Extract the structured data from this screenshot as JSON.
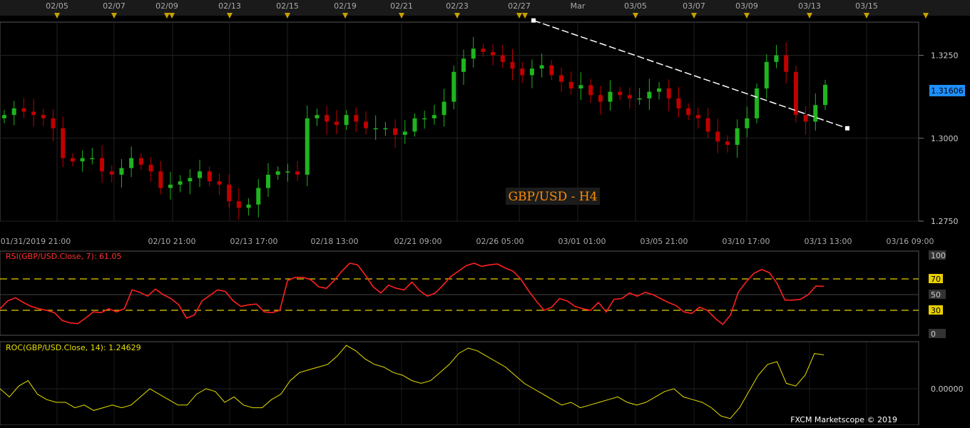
{
  "top_dates": [
    "02/05",
    "02/07",
    "02/09",
    "02/13",
    "02/15",
    "02/19",
    "02/21",
    "02/23",
    "02/27",
    "Mar",
    "03/05",
    "03/07",
    "03/09",
    "03/13",
    "03/15"
  ],
  "main": {
    "title": "GBP/USD - H4",
    "price_ticks": [
      "1.3250",
      "1.3000",
      "1.2750"
    ],
    "current_price": "1.31606",
    "time_labels": [
      "01/31/2019 21:00",
      "02/10 21:00",
      "02/13 17:00",
      "02/18 13:00",
      "02/21 09:00",
      "02/26 05:00",
      "03/01 01:00",
      "03/05 21:00",
      "03/10 17:00",
      "03/13 13:00",
      "03/16 09:00"
    ],
    "colors": {
      "up": "#1fb51f",
      "down": "#c00000",
      "trendline": "#ffffff",
      "price_badge": "#1e90ff"
    }
  },
  "rsi": {
    "label": "RSI(GBP/USD.Close, 7): 61.05",
    "levels": [
      "100",
      "70",
      "50",
      "30",
      "0"
    ],
    "color": "#ff2020"
  },
  "roc": {
    "label": "ROC(GBP/USD.Close, 14): 1.24629",
    "zero_label": "0.00000",
    "color": "#e8e000"
  },
  "footer": {
    "copyright": "FXCM Marketscope © 2019"
  },
  "chart_data": [
    {
      "type": "candlestick",
      "title": "GBP/USD - H4",
      "ylim": [
        1.275,
        1.335
      ],
      "y_ticks": [
        1.275,
        1.3,
        1.325
      ],
      "last_close": 1.31606,
      "close_path": [
        1.307,
        1.309,
        1.308,
        1.307,
        1.306,
        1.303,
        1.294,
        1.293,
        1.294,
        1.294,
        1.29,
        1.289,
        1.291,
        1.294,
        1.292,
        1.29,
        1.285,
        1.286,
        1.287,
        1.288,
        1.29,
        1.287,
        1.286,
        1.281,
        1.279,
        1.28,
        1.285,
        1.289,
        1.29,
        1.29,
        1.289,
        1.306,
        1.307,
        1.305,
        1.304,
        1.307,
        1.305,
        1.303,
        1.303,
        1.303,
        1.301,
        1.302,
        1.306,
        1.306,
        1.307,
        1.311,
        1.32,
        1.324,
        1.327,
        1.326,
        1.325,
        1.323,
        1.321,
        1.319,
        1.321,
        1.322,
        1.319,
        1.317,
        1.315,
        1.316,
        1.313,
        1.311,
        1.314,
        1.313,
        1.312,
        1.312,
        1.314,
        1.315,
        1.312,
        1.309,
        1.307,
        1.306,
        1.302,
        1.299,
        1.298,
        1.303,
        1.306,
        1.315,
        1.323,
        1.325,
        1.32,
        1.307,
        1.305,
        1.31,
        1.3161
      ],
      "trendline": {
        "start": 1.3355,
        "end": 1.303
      }
    },
    {
      "type": "line",
      "title": "RSI(GBP/USD.Close, 7): 61.05",
      "ylim": [
        0,
        100
      ],
      "levels": [
        30,
        50,
        70
      ],
      "last": 61.05,
      "values": [
        32,
        42,
        46,
        40,
        35,
        32,
        30,
        27,
        17,
        14,
        13,
        20,
        28,
        27,
        32,
        28,
        32,
        56,
        53,
        48,
        57,
        50,
        45,
        37,
        20,
        24,
        42,
        49,
        56,
        54,
        42,
        35,
        37,
        38,
        28,
        27,
        30,
        68,
        72,
        72,
        69,
        60,
        58,
        68,
        80,
        90,
        88,
        75,
        60,
        52,
        62,
        58,
        56,
        66,
        55,
        48,
        52,
        62,
        73,
        80,
        87,
        90,
        86,
        88,
        89,
        84,
        80,
        70,
        55,
        42,
        30,
        34,
        45,
        42,
        35,
        32,
        30,
        40,
        28,
        44,
        45,
        52,
        48,
        53,
        50,
        45,
        40,
        36,
        28,
        26,
        34,
        30,
        20,
        12,
        24,
        53,
        66,
        77,
        82,
        78,
        64,
        43,
        43,
        44,
        50,
        61,
        60.5
      ]
    },
    {
      "type": "line",
      "title": "ROC(GBP/USD.Close, 14): 1.24629",
      "zero": 0.0,
      "last": 1.24629,
      "values": [
        0.0,
        -0.3,
        0.1,
        0.3,
        -0.2,
        -0.4,
        -0.5,
        -0.5,
        -0.7,
        -0.6,
        -0.8,
        -0.7,
        -0.6,
        -0.7,
        -0.6,
        -0.3,
        0.0,
        -0.2,
        -0.4,
        -0.6,
        -0.6,
        -0.2,
        0.0,
        -0.1,
        -0.5,
        -0.3,
        -0.6,
        -0.7,
        -0.7,
        -0.4,
        -0.2,
        0.3,
        0.6,
        0.7,
        0.8,
        0.9,
        1.2,
        1.6,
        1.4,
        1.1,
        0.9,
        0.8,
        0.6,
        0.5,
        0.3,
        0.2,
        0.3,
        0.6,
        0.9,
        1.3,
        1.5,
        1.4,
        1.2,
        1.0,
        0.8,
        0.5,
        0.2,
        0.0,
        -0.2,
        -0.4,
        -0.6,
        -0.5,
        -0.7,
        -0.6,
        -0.5,
        -0.4,
        -0.3,
        -0.5,
        -0.6,
        -0.5,
        -0.3,
        -0.1,
        0.0,
        -0.3,
        -0.4,
        -0.5,
        -0.7,
        -1.0,
        -1.1,
        -0.7,
        -0.1,
        0.5,
        0.9,
        1.0,
        0.2,
        0.1,
        0.5,
        1.3,
        1.25
      ]
    }
  ]
}
